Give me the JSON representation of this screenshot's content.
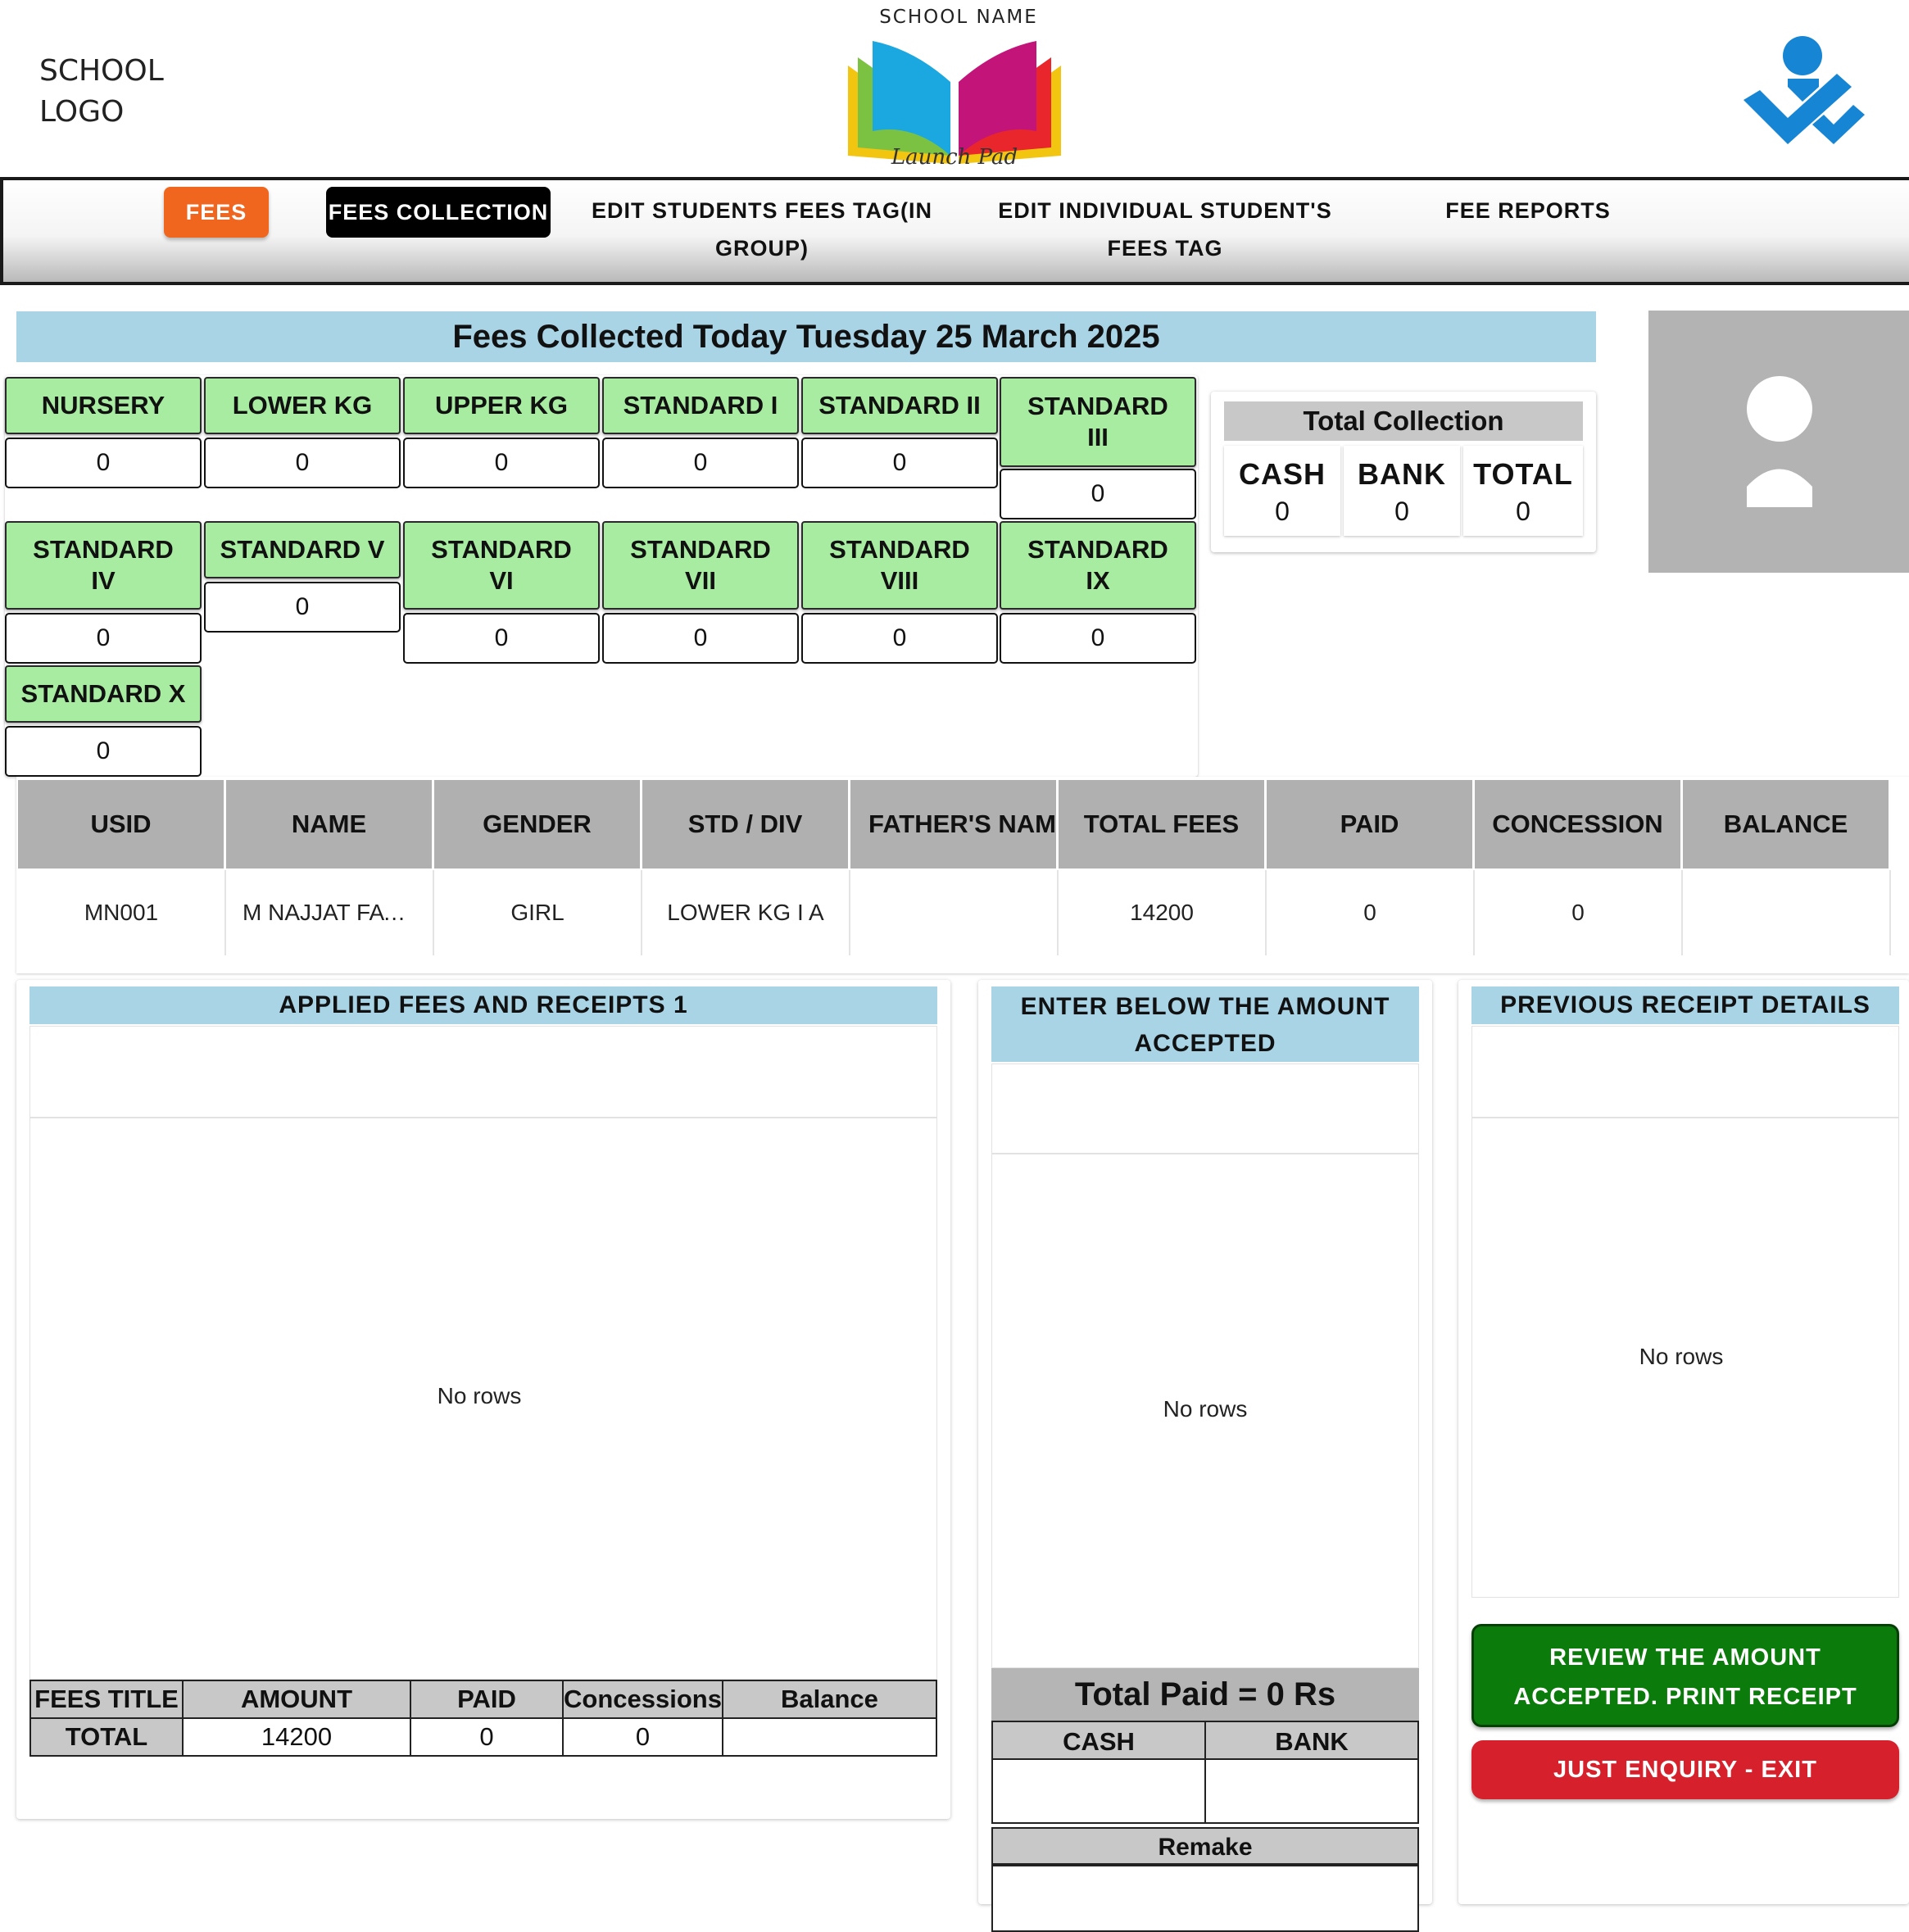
{
  "header": {
    "school_logo_line1": "SCHOOL",
    "school_logo_line2": "LOGO",
    "school_name": "SCHOOL NAME",
    "center_logo_text": "Launch Pad"
  },
  "nav": {
    "fees": "FEES",
    "fees_collection": "FEES COLLECTION",
    "edit_group_line1": "EDIT STUDENTS FEES TAG(IN",
    "edit_group_line2": "GROUP)",
    "edit_individual_line1": "EDIT INDIVIDUAL STUDENT'S",
    "edit_individual_line2": "FEES TAG",
    "fee_reports": "FEE REPORTS"
  },
  "today_title": "Fees Collected Today Tuesday 25 March 2025",
  "classes": [
    {
      "name": "NURSERY",
      "value": "0"
    },
    {
      "name": "LOWER KG",
      "value": "0"
    },
    {
      "name": "UPPER KG",
      "value": "0"
    },
    {
      "name": "STANDARD I",
      "value": "0"
    },
    {
      "name": "STANDARD II",
      "value": "0"
    },
    {
      "name": "STANDARD III",
      "value": "0"
    },
    {
      "name": "STANDARD IV",
      "value": "0"
    },
    {
      "name": "STANDARD V",
      "value": "0"
    },
    {
      "name": "STANDARD VI",
      "value": "0"
    },
    {
      "name": "STANDARD VII",
      "value": "0"
    },
    {
      "name": "STANDARD VIII",
      "value": "0"
    },
    {
      "name": "STANDARD IX",
      "value": "0"
    },
    {
      "name": "STANDARD X",
      "value": "0"
    }
  ],
  "total_collection": {
    "title": "Total Collection",
    "cash_label": "CASH",
    "cash_value": "0",
    "bank_label": "BANK",
    "bank_value": "0",
    "total_label": "TOTAL",
    "total_value": "0"
  },
  "student_table": {
    "columns": [
      "USID",
      "NAME",
      "GENDER",
      "STD / DIV",
      "FATHER'S NAME",
      "TOTAL FEES",
      "PAID",
      "CONCESSION",
      "BALANCE"
    ],
    "row": [
      "MN001",
      "M NAJJAT FATIMA",
      "GIRL",
      "LOWER KG I A",
      "",
      "14200",
      "0",
      "0",
      ""
    ]
  },
  "applied_fees": {
    "title": "APPLIED FEES AND RECEIPTS 1",
    "empty_text": "No rows",
    "summary_headers": [
      "FEES TITLE",
      "AMOUNT",
      "PAID",
      "Concessions",
      "Balance"
    ],
    "summary_row": [
      "TOTAL",
      "14200",
      "0",
      "0",
      ""
    ]
  },
  "amount_accepted": {
    "title_line1": "ENTER BELOW THE AMOUNT",
    "title_line2": "ACCEPTED",
    "empty_text": "No rows",
    "total_paid": "Total Paid = 0 Rs",
    "cash_label": "CASH",
    "bank_label": "BANK",
    "remark_label": "Remake"
  },
  "previous_receipts": {
    "title": "PREVIOUS RECEIPT DETAILS",
    "empty_text": "No rows"
  },
  "buttons": {
    "review_line1": "REVIEW THE AMOUNT",
    "review_line2": "ACCEPTED. PRINT RECEIPT",
    "exit": "JUST ENQUIRY - EXIT"
  },
  "colors": {
    "fees_button": "#f0661e",
    "class_tile": "#a8eca2",
    "section_header": "#a8d4e6",
    "review_button": "#0b7b0b",
    "exit_button": "#d6202c"
  }
}
